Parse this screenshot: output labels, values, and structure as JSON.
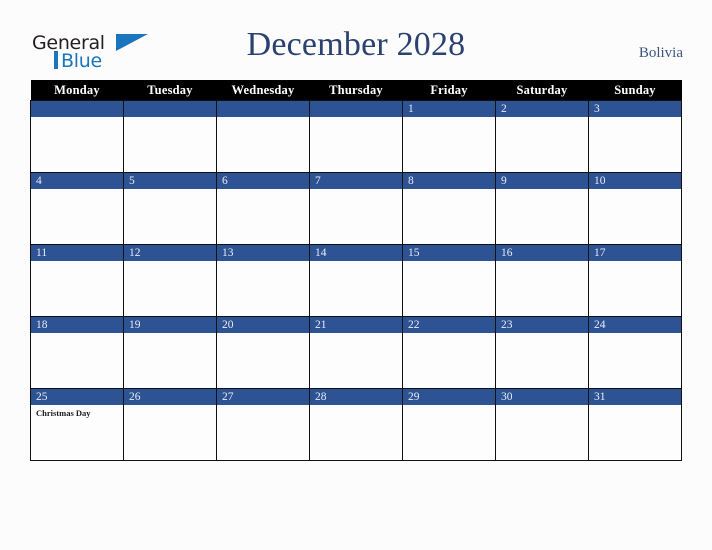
{
  "brand": {
    "name_line1": "General",
    "name_line2": "Blue",
    "triangle_icon": "blue-triangle-icon",
    "color_dark": "#231f20",
    "color_blue": "#1b75bc"
  },
  "header": {
    "title": "December 2028",
    "country": "Bolivia",
    "title_color": "#2b4170",
    "country_color": "#3c5580"
  },
  "theme": {
    "header_row_bg": "#000000",
    "header_row_text": "#ffffff",
    "date_bar_bg": "#2e5395",
    "date_bar_text": "#e8ecf5",
    "cell_bg": "#fdfdfd",
    "grid_line": "#111111",
    "page_bg": "#fcfcfd"
  },
  "weekdays": [
    "Monday",
    "Tuesday",
    "Wednesday",
    "Thursday",
    "Friday",
    "Saturday",
    "Sunday"
  ],
  "weeks": [
    [
      {
        "date": "",
        "events": []
      },
      {
        "date": "",
        "events": []
      },
      {
        "date": "",
        "events": []
      },
      {
        "date": "",
        "events": []
      },
      {
        "date": "1",
        "events": []
      },
      {
        "date": "2",
        "events": []
      },
      {
        "date": "3",
        "events": []
      }
    ],
    [
      {
        "date": "4",
        "events": []
      },
      {
        "date": "5",
        "events": []
      },
      {
        "date": "6",
        "events": []
      },
      {
        "date": "7",
        "events": []
      },
      {
        "date": "8",
        "events": []
      },
      {
        "date": "9",
        "events": []
      },
      {
        "date": "10",
        "events": []
      }
    ],
    [
      {
        "date": "11",
        "events": []
      },
      {
        "date": "12",
        "events": []
      },
      {
        "date": "13",
        "events": []
      },
      {
        "date": "14",
        "events": []
      },
      {
        "date": "15",
        "events": []
      },
      {
        "date": "16",
        "events": []
      },
      {
        "date": "17",
        "events": []
      }
    ],
    [
      {
        "date": "18",
        "events": []
      },
      {
        "date": "19",
        "events": []
      },
      {
        "date": "20",
        "events": []
      },
      {
        "date": "21",
        "events": []
      },
      {
        "date": "22",
        "events": []
      },
      {
        "date": "23",
        "events": []
      },
      {
        "date": "24",
        "events": []
      }
    ],
    [
      {
        "date": "25",
        "events": [
          "Christmas Day"
        ]
      },
      {
        "date": "26",
        "events": []
      },
      {
        "date": "27",
        "events": []
      },
      {
        "date": "28",
        "events": []
      },
      {
        "date": "29",
        "events": []
      },
      {
        "date": "30",
        "events": []
      },
      {
        "date": "31",
        "events": []
      }
    ]
  ]
}
